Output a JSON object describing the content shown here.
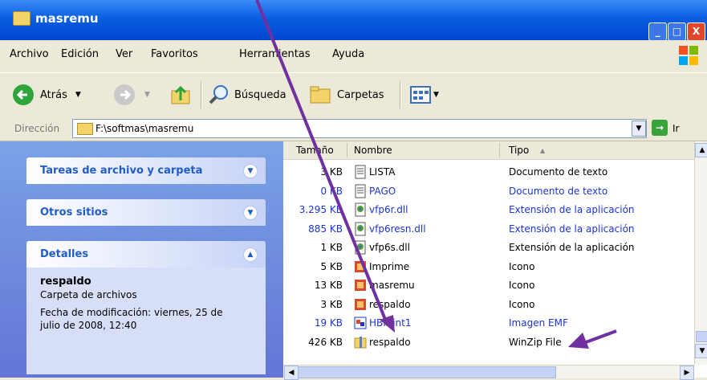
{
  "window": {
    "title": "masremu",
    "min": "_",
    "max": "□",
    "close": "X"
  },
  "menu": [
    "Archivo",
    "Edición",
    "Ver",
    "Favoritos",
    "Herramientas",
    "Ayuda"
  ],
  "toolbar": {
    "back": "Atrás",
    "search": "Búsqueda",
    "folders": "Carpetas"
  },
  "address": {
    "label": "Dirección",
    "path": "F:\\softmas\\masremu",
    "go": "Ir"
  },
  "tasks": {
    "file_tasks": "Tareas de archivo y carpeta",
    "other_places": "Otros sitios",
    "details": "Detalles",
    "details_name": "respaldo",
    "details_type": "Carpeta de archivos",
    "details_mod1": "Fecha de modificación: viernes, 25 de",
    "details_mod2": "julio de 2008, 12:40"
  },
  "columns": {
    "size": "Tamaño",
    "name": "Nombre",
    "type": "Tipo"
  },
  "files": [
    {
      "size": "3 KB",
      "name": "LISTA",
      "type": "Documento de texto",
      "icon": "text-file-icon",
      "blue": false
    },
    {
      "size": "0 KB",
      "name": "PAGO",
      "type": "Documento de texto",
      "icon": "text-file-icon",
      "blue": true
    },
    {
      "size": "3.295 KB",
      "name": "vfp6r.dll",
      "type": "Extensión de la aplicación",
      "icon": "dll-file-icon",
      "blue": true
    },
    {
      "size": "885 KB",
      "name": "vfp6resn.dll",
      "type": "Extensión de la aplicación",
      "icon": "dll-file-icon",
      "blue": true
    },
    {
      "size": "1 KB",
      "name": "vfp6s.dll",
      "type": "Extensión de la aplicación",
      "icon": "dll-file-icon",
      "blue": false
    },
    {
      "size": "5 KB",
      "name": "Imprime",
      "type": "Icono",
      "icon": "ico-file-icon",
      "blue": false
    },
    {
      "size": "13 KB",
      "name": "masremu",
      "type": "Icono",
      "icon": "ico-file-icon",
      "blue": false
    },
    {
      "size": "3 KB",
      "name": "respaldo",
      "type": "Icono",
      "icon": "ico-file-icon",
      "blue": false
    },
    {
      "size": "19 KB",
      "name": "HBPrint1",
      "type": "Imagen EMF",
      "icon": "emf-file-icon",
      "blue": true
    },
    {
      "size": "426 KB",
      "name": "respaldo",
      "type": "WinZip File",
      "icon": "zip-file-icon",
      "blue": false
    }
  ],
  "colors": {
    "annotation_arrow": "#7030a0"
  }
}
